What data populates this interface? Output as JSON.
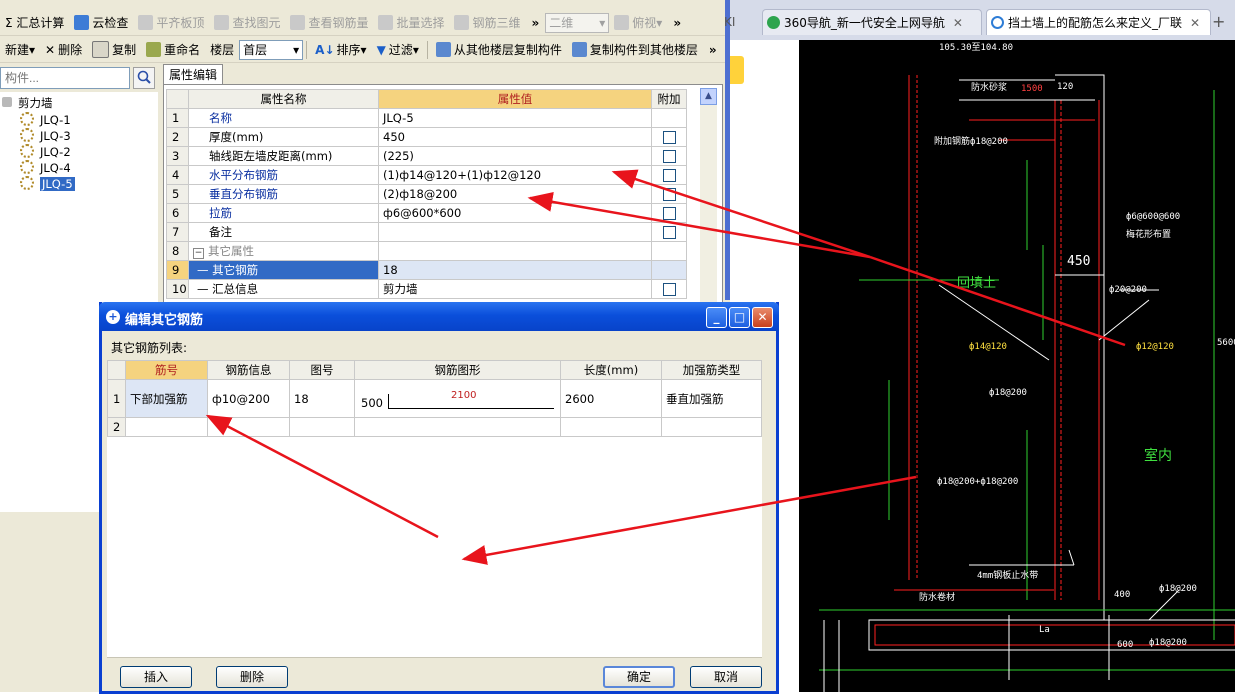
{
  "toolbar1": {
    "items": [
      {
        "icon": "calculator-icon",
        "label": "Σ 汇总计算",
        "enabled": true
      },
      {
        "icon": "cloud-check-icon",
        "label": "云检查",
        "enabled": true
      },
      {
        "icon": "align-slab-icon",
        "label": "平齐板顶",
        "enabled": false
      },
      {
        "icon": "find-element-icon",
        "label": "查找图元",
        "enabled": false
      },
      {
        "icon": "view-rebar-icon",
        "label": "查看钢筋量",
        "enabled": false
      },
      {
        "icon": "batch-select-icon",
        "label": "批量选择",
        "enabled": false
      },
      {
        "icon": "rebar-3d-icon",
        "label": "钢筋三维",
        "enabled": false
      }
    ],
    "view_mode": "二维",
    "view_dir": "俯视"
  },
  "toolbar2": {
    "new_label": "新建",
    "delete_label": "删除",
    "copy_label": "复制",
    "rename_label": "重命名",
    "floor_label": "楼层",
    "floor_value": "首层",
    "sort_label": "排序",
    "filter_label": "过滤",
    "copy_from_floor_label": "从其他楼层复制构件",
    "copy_to_floor_label": "复制构件到其他楼层"
  },
  "tree": {
    "search_placeholder": "构件...",
    "root": "剪力墙",
    "items": [
      "JLQ-1",
      "JLQ-3",
      "JLQ-2",
      "JLQ-4",
      "JLQ-5"
    ],
    "selected": "JLQ-5"
  },
  "properties": {
    "tab": "属性编辑",
    "headers": {
      "name": "属性名称",
      "value": "属性值",
      "extra": "附加"
    },
    "rows": [
      {
        "n": "1",
        "name": "名称",
        "value": "JLQ-5",
        "style": "blue",
        "check": false
      },
      {
        "n": "2",
        "name": "厚度(mm)",
        "value": "450",
        "style": "normal",
        "check": true
      },
      {
        "n": "3",
        "name": "轴线距左墙皮距离(mm)",
        "value": "(225)",
        "style": "normal",
        "check": true
      },
      {
        "n": "4",
        "name": "水平分布钢筋",
        "value": "(1)ф14@120+(1)ф12@120",
        "style": "blue",
        "check": true
      },
      {
        "n": "5",
        "name": "垂直分布钢筋",
        "value": "(2)ф18@200",
        "style": "blue",
        "check": true
      },
      {
        "n": "6",
        "name": "拉筋",
        "value": "ф6@600*600",
        "style": "blue",
        "check": true
      },
      {
        "n": "7",
        "name": "备注",
        "value": "",
        "style": "normal",
        "check": true
      },
      {
        "n": "8",
        "name": "其它属性",
        "value": "",
        "style": "group",
        "check": false
      },
      {
        "n": "9",
        "name": "其它钢筋",
        "value": "18",
        "style": "selected",
        "check": false
      },
      {
        "n": "10",
        "name": "汇总信息",
        "value": "剪力墙",
        "style": "child",
        "check": true
      }
    ]
  },
  "browser": {
    "tabs": [
      {
        "label": "KI"
      },
      {
        "label": "360导航_新一代安全上网导航"
      },
      {
        "label": "挡土墙上的配筋怎么来定义_厂联"
      }
    ],
    "new_tab": "+"
  },
  "cad": {
    "labels": [
      "105.30至104.80",
      "防水砂浆",
      "1500",
      "120",
      "附加钢筋ф18@200",
      "ф6@600@600",
      "梅花形布置",
      "450",
      "回填土",
      "ф20@200",
      "ф14@120",
      "ф12@120",
      "5600",
      "ф18@200",
      "ф18@200+ф18@200",
      "室内",
      "4mm钢板止水带",
      "防水卷材",
      "400",
      "ф18@200",
      "La",
      "600",
      "ф18@200"
    ]
  },
  "dialog": {
    "title": "编辑其它钢筋",
    "list_label": "其它钢筋列表:",
    "headers": [
      "筋号",
      "钢筋信息",
      "图号",
      "钢筋图形",
      "长度(mm)",
      "加强筋类型"
    ],
    "rows": [
      {
        "n": "1",
        "name": "下部加强筋",
        "info": "ф10@200",
        "fig": "18",
        "shape_left": "500",
        "shape_len": "2100",
        "length": "2600",
        "type": "垂直加强筋"
      },
      {
        "n": "2",
        "name": "",
        "info": "",
        "fig": "",
        "shape_left": "",
        "shape_len": "",
        "length": "",
        "type": ""
      }
    ],
    "buttons": {
      "insert": "插入",
      "delete": "删除",
      "ok": "确定",
      "cancel": "取消"
    }
  },
  "colors": {
    "accent": "#0a3fd1",
    "annotation_arrow": "#e8141c",
    "cad_bg": "#000000"
  }
}
